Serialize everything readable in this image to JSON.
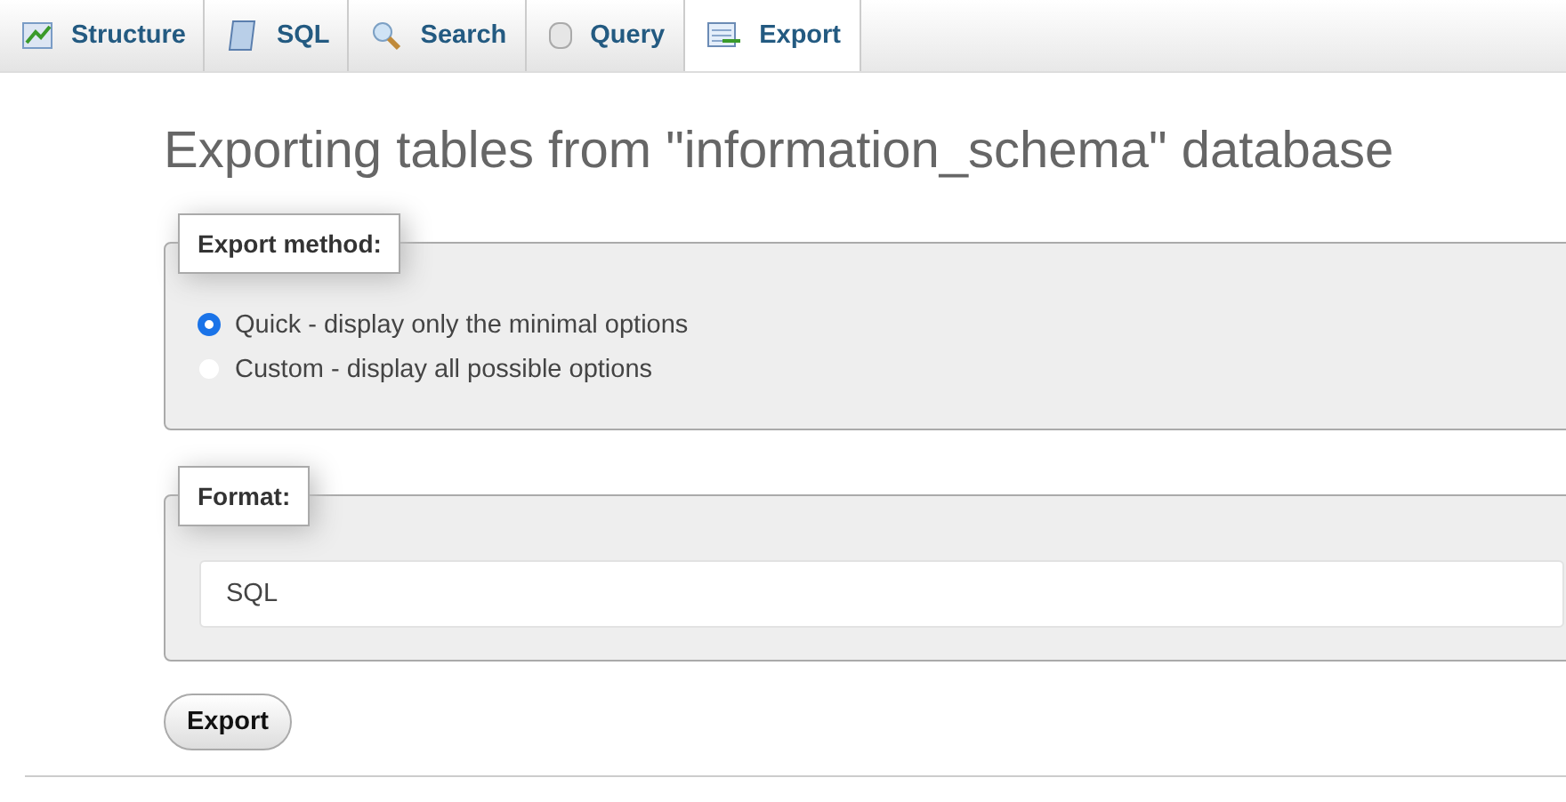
{
  "tabs": [
    {
      "label": "Structure",
      "kind": "structure",
      "selected": false
    },
    {
      "label": "SQL",
      "kind": "sql",
      "selected": false
    },
    {
      "label": "Search",
      "kind": "search",
      "selected": false
    },
    {
      "label": "Query",
      "kind": "query",
      "selected": false
    },
    {
      "label": "Export",
      "kind": "export",
      "selected": true
    }
  ],
  "title": "Exporting tables from \"information_schema\" database",
  "export_method": {
    "legend": "Export method:",
    "options": [
      {
        "label": "Quick - display only the minimal options",
        "selected": true
      },
      {
        "label": "Custom - display all possible options",
        "selected": false
      }
    ]
  },
  "format": {
    "legend": "Format:",
    "value": "SQL"
  },
  "submit": "Export"
}
